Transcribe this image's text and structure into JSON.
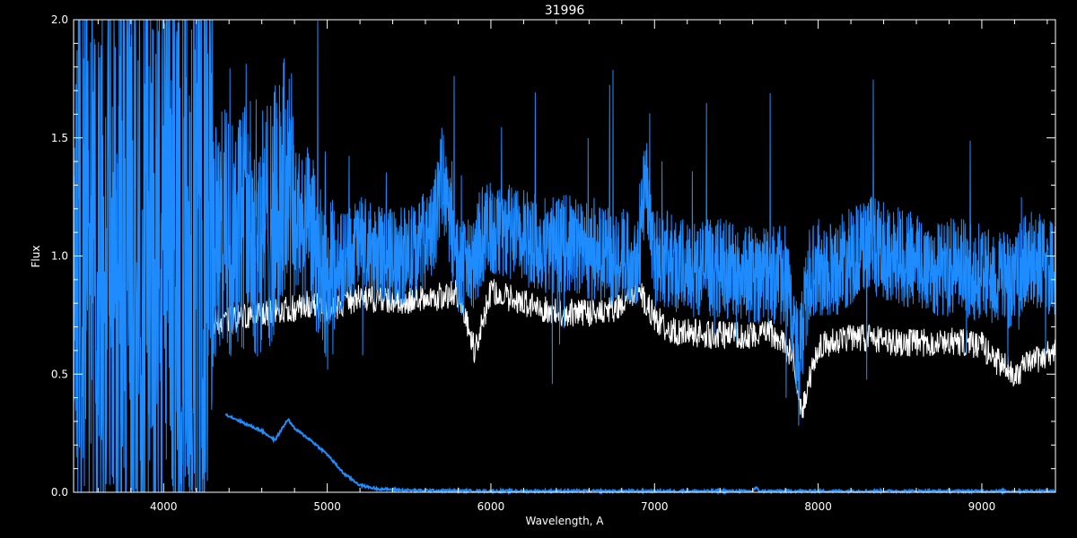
{
  "chart_data": {
    "type": "line",
    "title": "31996",
    "xlabel": "Wavelength, A",
    "ylabel": "Flux",
    "xlim": [
      3450,
      9450
    ],
    "ylim": [
      0.0,
      2.0
    ],
    "x_ticks": [
      4000,
      5000,
      6000,
      7000,
      8000,
      9000
    ],
    "x_tick_labels": [
      "4000",
      "5000",
      "6000",
      "7000",
      "8000",
      "9000"
    ],
    "y_ticks": [
      0.0,
      0.5,
      1.0,
      1.5,
      2.0
    ],
    "y_tick_labels": [
      "0.0",
      "0.5",
      "1.0",
      "1.5",
      "2.0"
    ],
    "grid": false,
    "legend": "none",
    "colors": {
      "background": "#000000",
      "axes": "#ffffff",
      "flux": "#1e8cff",
      "model": "#ffffff",
      "error": "#1e8cff"
    },
    "series": [
      {
        "role": "model",
        "x": [
          4300,
          4500,
          4700,
          4900,
          5000,
          5200,
          5400,
          5600,
          5800,
          5900,
          6000,
          6200,
          6400,
          6600,
          6800,
          6900,
          7000,
          7100,
          7300,
          7500,
          7700,
          7850,
          7900,
          8000,
          8200,
          8400,
          8600,
          8800,
          9000,
          9100,
          9200,
          9300,
          9450
        ],
        "y": [
          0.72,
          0.74,
          0.76,
          0.8,
          0.78,
          0.82,
          0.8,
          0.82,
          0.84,
          0.6,
          0.85,
          0.8,
          0.76,
          0.76,
          0.78,
          0.86,
          0.74,
          0.68,
          0.67,
          0.66,
          0.68,
          0.58,
          0.34,
          0.62,
          0.66,
          0.64,
          0.63,
          0.64,
          0.62,
          0.55,
          0.5,
          0.55,
          0.6
        ]
      },
      {
        "role": "flux",
        "x": [
          3450,
          3700,
          4000,
          4200,
          4300,
          4400,
          4500,
          4600,
          4700,
          4750,
          4800,
          4900,
          5000,
          5100,
          5200,
          5300,
          5500,
          5650,
          5700,
          5800,
          5890,
          5950,
          6100,
          6300,
          6500,
          6700,
          6900,
          6950,
          7000,
          7200,
          7400,
          7600,
          7800,
          7880,
          7950,
          8100,
          8300,
          8500,
          8700,
          8900,
          9100,
          9200,
          9300,
          9400,
          9450
        ],
        "y": [
          1.0,
          1.0,
          1.0,
          1.0,
          1.05,
          1.1,
          1.15,
          1.1,
          1.2,
          1.35,
          1.15,
          1.1,
          0.85,
          1.0,
          1.05,
          1.0,
          1.0,
          1.1,
          1.35,
          0.95,
          0.95,
          1.1,
          1.1,
          1.05,
          1.05,
          1.0,
          1.0,
          1.35,
          1.0,
          0.95,
          0.95,
          0.92,
          0.92,
          0.55,
          0.95,
          0.95,
          1.05,
          1.0,
          0.95,
          0.95,
          0.9,
          0.9,
          1.0,
          0.95,
          0.95
        ]
      },
      {
        "role": "error",
        "x": [
          4380,
          4500,
          4600,
          4680,
          4760,
          4800,
          4900,
          5000,
          5100,
          5200,
          5300,
          5500,
          6000,
          7000,
          7600,
          7620,
          7640,
          8000,
          9000,
          9450
        ],
        "y": [
          0.33,
          0.29,
          0.26,
          0.22,
          0.31,
          0.27,
          0.22,
          0.16,
          0.08,
          0.03,
          0.015,
          0.008,
          0.005,
          0.005,
          0.005,
          0.02,
          0.005,
          0.005,
          0.005,
          0.005
        ]
      }
    ]
  }
}
